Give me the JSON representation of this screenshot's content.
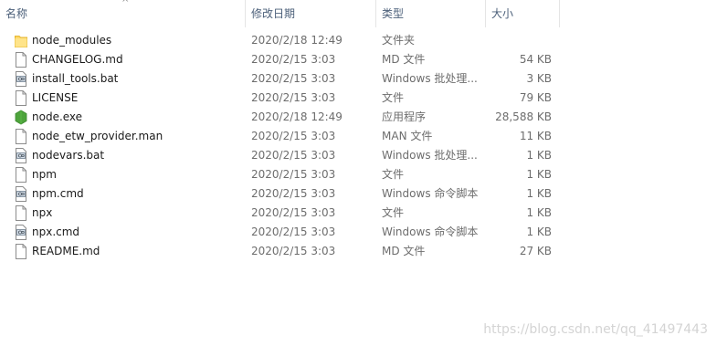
{
  "columns": {
    "name": "名称",
    "date_modified": "修改日期",
    "type": "类型",
    "size": "大小"
  },
  "sort_indicator": "^",
  "rows": [
    {
      "name": "node_modules",
      "date": "2020/2/18 12:49",
      "type": "文件夹",
      "size": "",
      "icon": "folder-icon"
    },
    {
      "name": "CHANGELOG.md",
      "date": "2020/2/15 3:03",
      "type": "MD 文件",
      "size": "54 KB",
      "icon": "file-icon"
    },
    {
      "name": "install_tools.bat",
      "date": "2020/2/15 3:03",
      "type": "Windows 批处理...",
      "size": "3 KB",
      "icon": "batch-file-icon"
    },
    {
      "name": "LICENSE",
      "date": "2020/2/15 3:03",
      "type": "文件",
      "size": "79 KB",
      "icon": "file-icon"
    },
    {
      "name": "node.exe",
      "date": "2020/2/18 12:49",
      "type": "应用程序",
      "size": "28,588 KB",
      "icon": "nodejs-icon"
    },
    {
      "name": "node_etw_provider.man",
      "date": "2020/2/15 3:03",
      "type": "MAN 文件",
      "size": "11 KB",
      "icon": "file-icon"
    },
    {
      "name": "nodevars.bat",
      "date": "2020/2/15 3:03",
      "type": "Windows 批处理...",
      "size": "1 KB",
      "icon": "batch-file-icon"
    },
    {
      "name": "npm",
      "date": "2020/2/15 3:03",
      "type": "文件",
      "size": "1 KB",
      "icon": "file-icon"
    },
    {
      "name": "npm.cmd",
      "date": "2020/2/15 3:03",
      "type": "Windows 命令脚本",
      "size": "1 KB",
      "icon": "batch-file-icon"
    },
    {
      "name": "npx",
      "date": "2020/2/15 3:03",
      "type": "文件",
      "size": "1 KB",
      "icon": "file-icon"
    },
    {
      "name": "npx.cmd",
      "date": "2020/2/15 3:03",
      "type": "Windows 命令脚本",
      "size": "1 KB",
      "icon": "batch-file-icon"
    },
    {
      "name": "README.md",
      "date": "2020/2/15 3:03",
      "type": "MD 文件",
      "size": "27 KB",
      "icon": "file-icon"
    }
  ],
  "watermark": "https://blog.csdn.net/qq_41497443"
}
